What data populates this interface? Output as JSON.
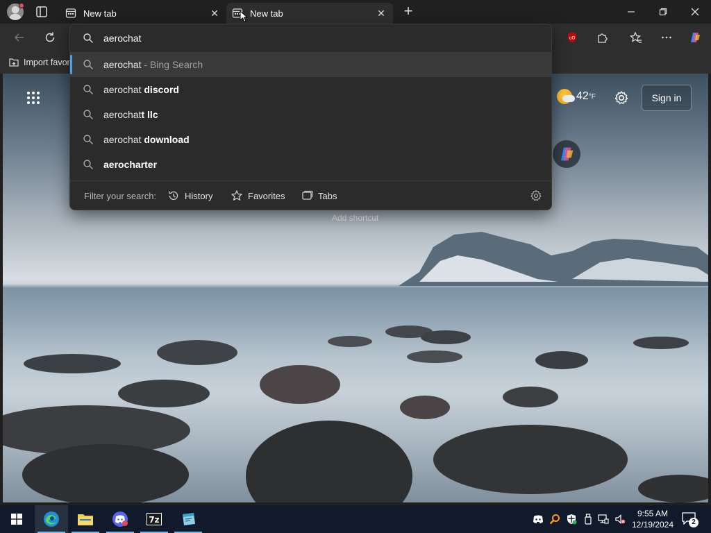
{
  "tabs": [
    {
      "title": "New tab",
      "close": "✕"
    },
    {
      "title": "New tab",
      "close": "✕"
    }
  ],
  "new_tab_glyph": "+",
  "address_bar": {
    "query": "aerochat"
  },
  "suggestions": [
    {
      "prefix": "aerochat",
      "bold": "",
      "meta": " - Bing Search",
      "active": true
    },
    {
      "prefix": "aerochat ",
      "bold": "discord",
      "meta": ""
    },
    {
      "prefix": "aerochat",
      "bold": "t llc",
      "meta": ""
    },
    {
      "prefix": "aerochat ",
      "bold": "download",
      "meta": ""
    },
    {
      "prefix": "",
      "bold": "aerocharter",
      "meta": ""
    }
  ],
  "filters": {
    "label": "Filter your search:",
    "history": "History",
    "favorites": "Favorites",
    "tabs": "Tabs"
  },
  "favorites_bar": {
    "import_label": "Import favor"
  },
  "new_tab_page": {
    "temperature": "42",
    "temp_unit": "°F",
    "sign_in": "Sign in",
    "add_shortcut": "Add shortcut"
  },
  "extension_badge": "uO",
  "taskbar": {
    "app_7z_label": "7z",
    "time": "9:55 AM",
    "date": "12/19/2024",
    "notification_count": "2"
  },
  "colors": {
    "accent": "#4ca0e0",
    "taskbar": "#101a2a",
    "chrome": "#2e2e2e"
  }
}
